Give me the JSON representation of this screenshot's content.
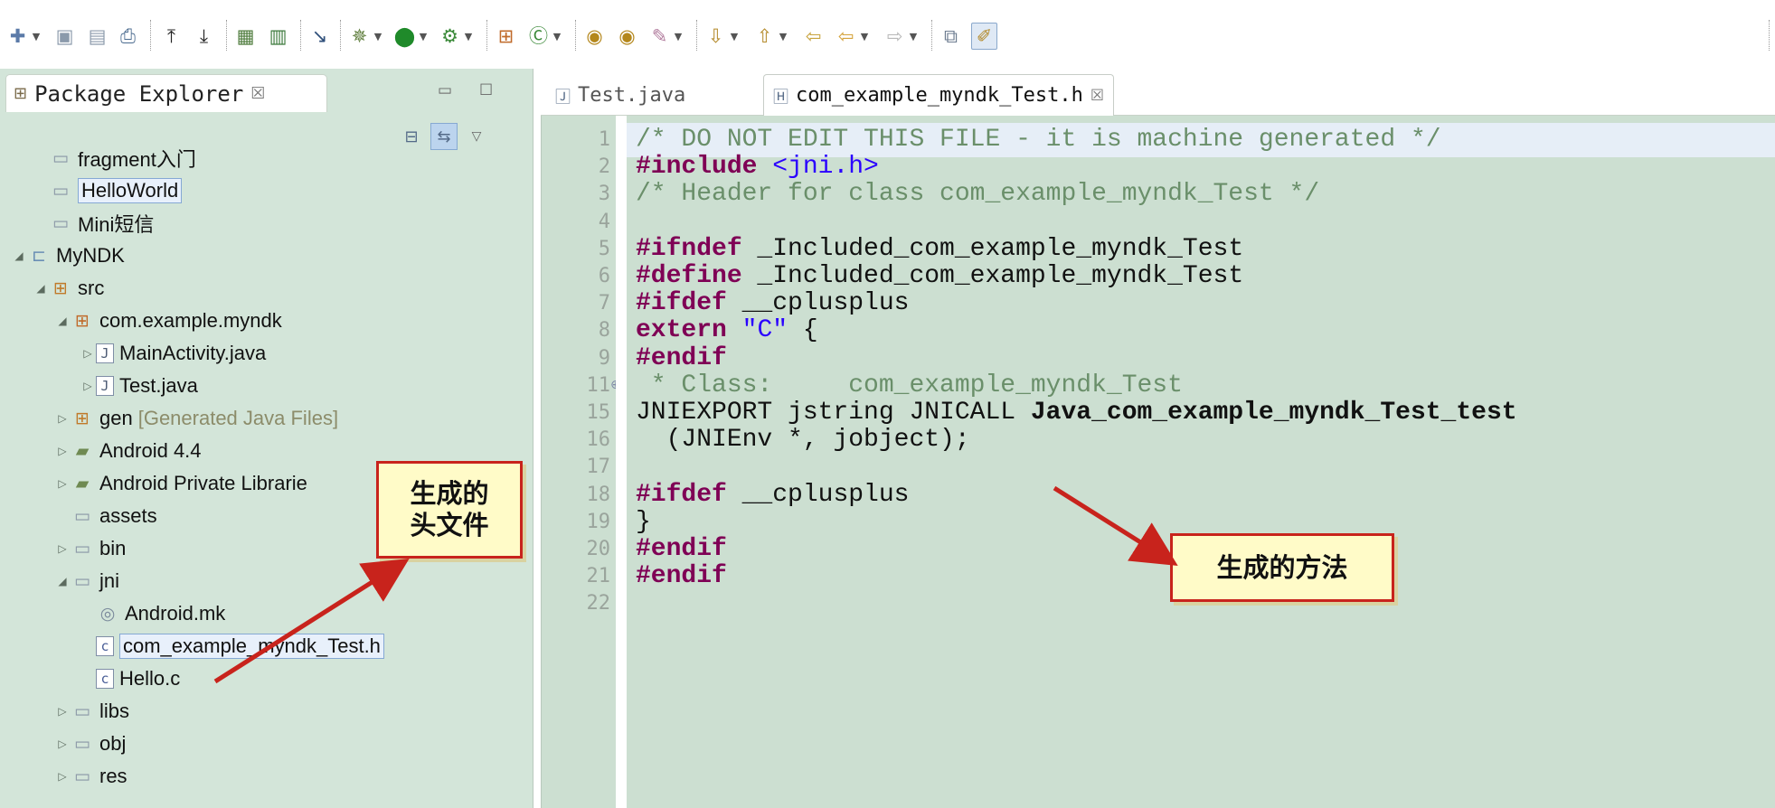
{
  "toolbar": {
    "icons": [
      "new-icon",
      "save-icon",
      "save-all-icon",
      "print-icon",
      "upload-icon",
      "download-icon",
      "sdk-manager-icon",
      "avd-manager-icon",
      "toggle-mark-icon",
      "debug-icon",
      "run-icon",
      "external-tools-icon",
      "new-package-icon",
      "new-class-icon",
      "open-type-icon",
      "open-task-icon",
      "pen-icon",
      "next-annotation-icon",
      "previous-annotation-icon",
      "back-icon",
      "back-arrow-icon",
      "forward-arrow-icon",
      "open-perspective-icon",
      "java-perspective-icon"
    ]
  },
  "package_explorer": {
    "title": "Package Explorer",
    "close_glyph": "☒",
    "minimize_glyph": "▭",
    "maximize_glyph": "☐",
    "menu_glyph": "▽",
    "collapse_glyph": "⊟",
    "link_glyph": "⇆",
    "tree": [
      {
        "label": "fragment入门",
        "icon": "folder-icon",
        "expanded": null
      },
      {
        "label": "HelloWorld",
        "icon": "folder-icon",
        "expanded": null,
        "selected": true
      },
      {
        "label": "Mini短信",
        "icon": "folder-icon",
        "expanded": null
      },
      {
        "label": "MyNDK",
        "icon": "android-project-icon",
        "expanded": true
      },
      {
        "label": "src",
        "icon": "source-folder-icon",
        "expanded": true
      },
      {
        "label": "com.example.myndk",
        "icon": "package-icon",
        "expanded": true
      },
      {
        "label": "MainActivity.java",
        "icon": "java-file-icon",
        "expanded": false
      },
      {
        "label": "Test.java",
        "icon": "java-file-icon",
        "expanded": false
      },
      {
        "label": "gen",
        "extra": "[Generated Java Files]",
        "icon": "source-folder-icon",
        "expanded": false
      },
      {
        "label": "Android 4.4",
        "icon": "library-icon",
        "expanded": false
      },
      {
        "label": "Android Private Librarie",
        "icon": "library-icon",
        "expanded": false
      },
      {
        "label": "assets",
        "icon": "folder-icon",
        "expanded": null
      },
      {
        "label": "bin",
        "icon": "folder-icon",
        "expanded": false
      },
      {
        "label": "jni",
        "icon": "folder-icon",
        "expanded": true
      },
      {
        "label": "Android.mk",
        "icon": "makefile-icon",
        "expanded": null
      },
      {
        "label": "com_example_myndk_Test.h",
        "icon": "c-header-icon",
        "expanded": null,
        "selected": true
      },
      {
        "label": "Hello.c",
        "icon": "c-file-icon",
        "expanded": null
      },
      {
        "label": "libs",
        "icon": "folder-icon",
        "expanded": false
      },
      {
        "label": "obj",
        "icon": "folder-icon",
        "expanded": false
      },
      {
        "label": "res",
        "icon": "folder-icon",
        "expanded": false
      }
    ]
  },
  "editor": {
    "tabs": [
      {
        "label": "Test.java",
        "active": false
      },
      {
        "label": "com_example_myndk_Test.h",
        "active": true,
        "close_glyph": "☒"
      }
    ],
    "line_numbers": [
      "1",
      "2",
      "3",
      "4",
      "5",
      "6",
      "7",
      "8",
      "9",
      "11",
      "15",
      "16",
      "17",
      "18",
      "19",
      "20",
      "21",
      "22"
    ],
    "fold_marker": "⊕",
    "lines": [
      "/* DO NOT EDIT THIS FILE - it is machine generated */",
      "#include <jni.h>",
      "/* Header for class com_example_myndk_Test */",
      "",
      "#ifndef _Included_com_example_myndk_Test",
      "#define _Included_com_example_myndk_Test",
      "#ifdef __cplusplus",
      "extern \"C\" {",
      "#endif",
      " * Class:     com_example_myndk_Test",
      "JNIEXPORT jstring JNICALL Java_com_example_myndk_Test_test",
      "  (JNIEnv *, jobject);",
      "",
      "#ifdef __cplusplus",
      "}",
      "#endif",
      "#endif",
      ""
    ]
  },
  "annotations": {
    "header_callout": "生成的\n头文件",
    "method_callout": "生成的方法",
    "color": "#c8231c"
  }
}
